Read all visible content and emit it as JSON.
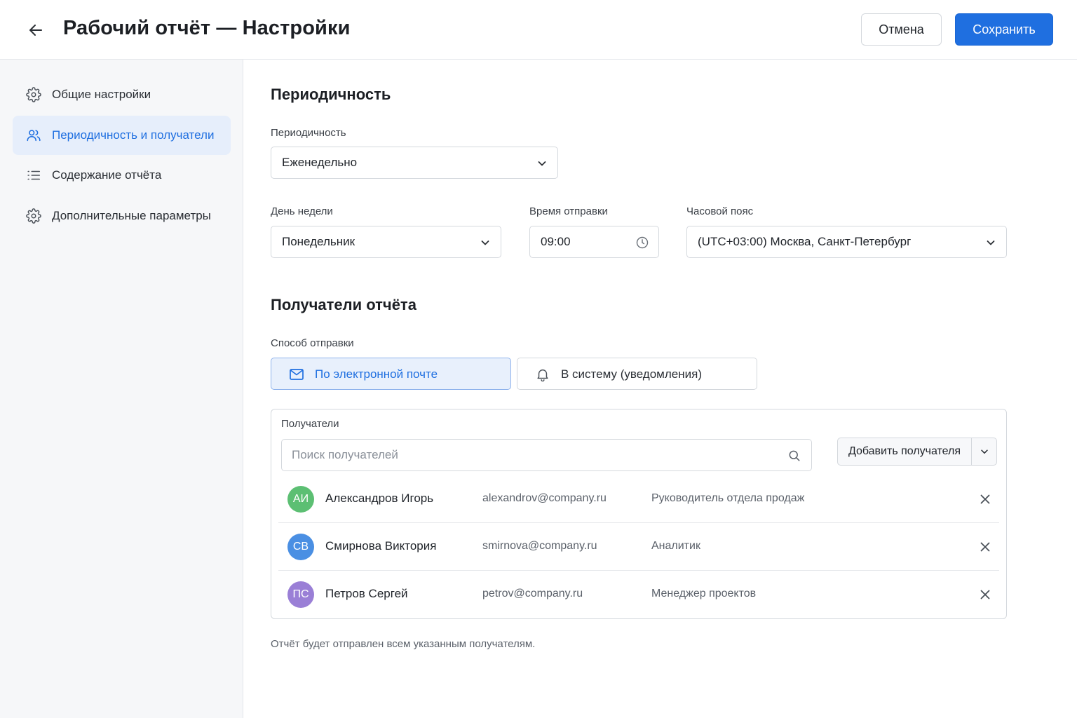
{
  "header": {
    "title": "Рабочий отчёт — Настройки",
    "cancel_label": "Отмена",
    "save_label": "Сохранить",
    "accent_color": "#1f6fe0"
  },
  "sidebar": {
    "items": [
      {
        "label": "Общие настройки",
        "icon": "gear-icon",
        "active": false
      },
      {
        "label": "Периодичность и получатели",
        "icon": "users-icon",
        "active": true
      },
      {
        "label": "Содержание отчёта",
        "icon": "list-icon",
        "active": false
      },
      {
        "label": "Дополнительные параметры",
        "icon": "gear-icon",
        "active": false
      }
    ]
  },
  "periodicity": {
    "section_title": "Периодичность",
    "frequency_label": "Периодичность",
    "frequency_value": "Еженедельно",
    "weekday_label": "День недели",
    "weekday_value": "Понедельник",
    "time_label": "Время отправки",
    "time_value": "09:00",
    "timezone_label": "Часовой пояс",
    "timezone_value": "(UTC+03:00) Москва, Санкт-Петербург"
  },
  "recipients": {
    "section_title": "Получатели отчёта",
    "method_label": "Способ отправки",
    "method_email": "По электронной почте",
    "method_system": "В систему (уведомления)",
    "selected_method": "email",
    "box_title": "Получатели",
    "search_placeholder": "Поиск получателей",
    "add_label": "Добавить получателя",
    "list": [
      {
        "initials": "АИ",
        "name": "Александров Игорь",
        "email": "alexandrov@company.ru",
        "role": "Руководитель отдела продаж",
        "color": "#5cbf73"
      },
      {
        "initials": "СВ",
        "name": "Смирнова Виктория",
        "email": "smirnova@company.ru",
        "role": "Аналитик",
        "color": "#4a8fe3"
      },
      {
        "initials": "ПС",
        "name": "Петров Сергей",
        "email": "petrov@company.ru",
        "role": "Менеджер проектов",
        "color": "#9a7fd6"
      }
    ],
    "note": "Отчёт будет отправлен всем указанным получателям."
  }
}
